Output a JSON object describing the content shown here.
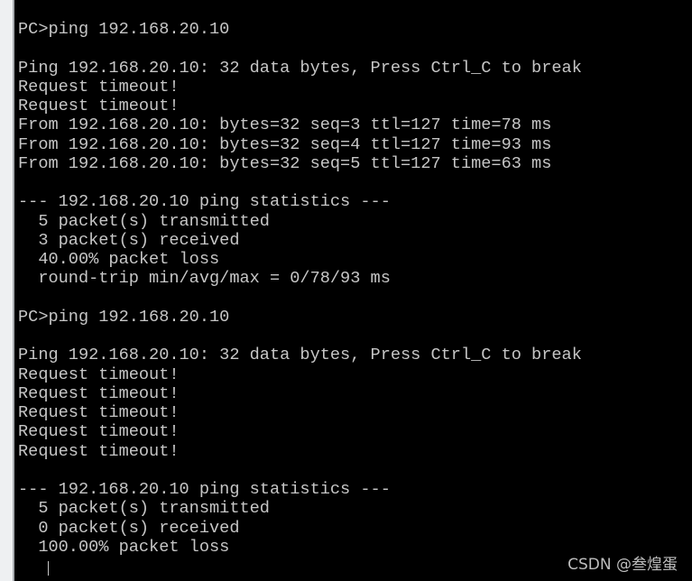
{
  "terminal": {
    "lines": [
      "PC>ping 192.168.20.10",
      "",
      "Ping 192.168.20.10: 32 data bytes, Press Ctrl_C to break",
      "Request timeout!",
      "Request timeout!",
      "From 192.168.20.10: bytes=32 seq=3 ttl=127 time=78 ms",
      "From 192.168.20.10: bytes=32 seq=4 ttl=127 time=93 ms",
      "From 192.168.20.10: bytes=32 seq=5 ttl=127 time=63 ms",
      "",
      "--- 192.168.20.10 ping statistics ---",
      "  5 packet(s) transmitted",
      "  3 packet(s) received",
      "  40.00% packet loss",
      "  round-trip min/avg/max = 0/78/93 ms",
      "",
      "PC>ping 192.168.20.10",
      "",
      "Ping 192.168.20.10: 32 data bytes, Press Ctrl_C to break",
      "Request timeout!",
      "Request timeout!",
      "Request timeout!",
      "Request timeout!",
      "Request timeout!",
      "",
      "--- 192.168.20.10 ping statistics ---",
      "  5 packet(s) transmitted",
      "  0 packet(s) received",
      "  100.00% packet loss"
    ]
  },
  "watermark": "CSDN @叁煌蛋",
  "colors": {
    "background": "#000000",
    "text": "#c6c6c6"
  }
}
